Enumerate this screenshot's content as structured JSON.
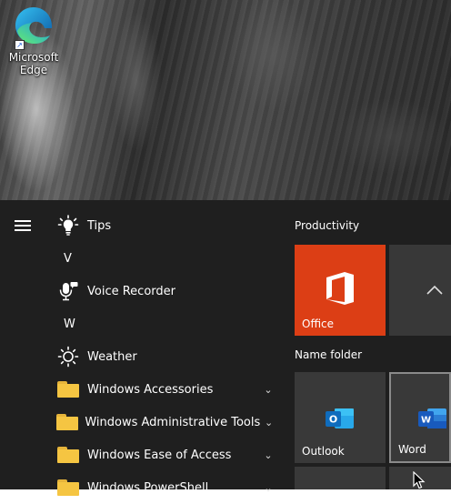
{
  "desktop": {
    "icons": [
      {
        "label": "Microsoft Edge",
        "icon": "edge-icon"
      }
    ]
  },
  "start_menu": {
    "menu_icon": "hamburger-icon",
    "app_list": [
      {
        "kind": "app",
        "label": "Tips",
        "icon": "lightbulb-icon"
      },
      {
        "kind": "letter",
        "label": "V"
      },
      {
        "kind": "app",
        "label": "Voice Recorder",
        "icon": "microphone-icon"
      },
      {
        "kind": "letter",
        "label": "W"
      },
      {
        "kind": "app",
        "label": "Weather",
        "icon": "sun-icon"
      },
      {
        "kind": "folder",
        "label": "Windows Accessories",
        "icon": "folder-icon"
      },
      {
        "kind": "folder",
        "label": "Windows Administrative Tools",
        "icon": "folder-icon"
      },
      {
        "kind": "folder",
        "label": "Windows Ease of Access",
        "icon": "folder-icon"
      },
      {
        "kind": "folder",
        "label": "Windows PowerShell",
        "icon": "folder-icon"
      }
    ],
    "tile_groups": [
      {
        "title": "Productivity",
        "tiles": [
          {
            "label": "Office",
            "icon": "office-icon",
            "color": "#dc3e15"
          },
          {
            "label": "",
            "icon": "chevron-up-icon",
            "color": "#383838"
          }
        ]
      },
      {
        "title": "Name folder",
        "tiles": [
          {
            "label": "Outlook",
            "icon": "outlook-icon",
            "color": "#393939"
          },
          {
            "label": "Word",
            "icon": "word-icon",
            "color": "#393939"
          }
        ]
      }
    ]
  },
  "colors": {
    "start_bg": "#1f1f1f",
    "tile_bg": "#393939",
    "office_orange": "#dc3e15",
    "folder_yellow": "#f5c542",
    "outlook_blue": "#0f6cbd",
    "word_blue": "#185abd"
  }
}
